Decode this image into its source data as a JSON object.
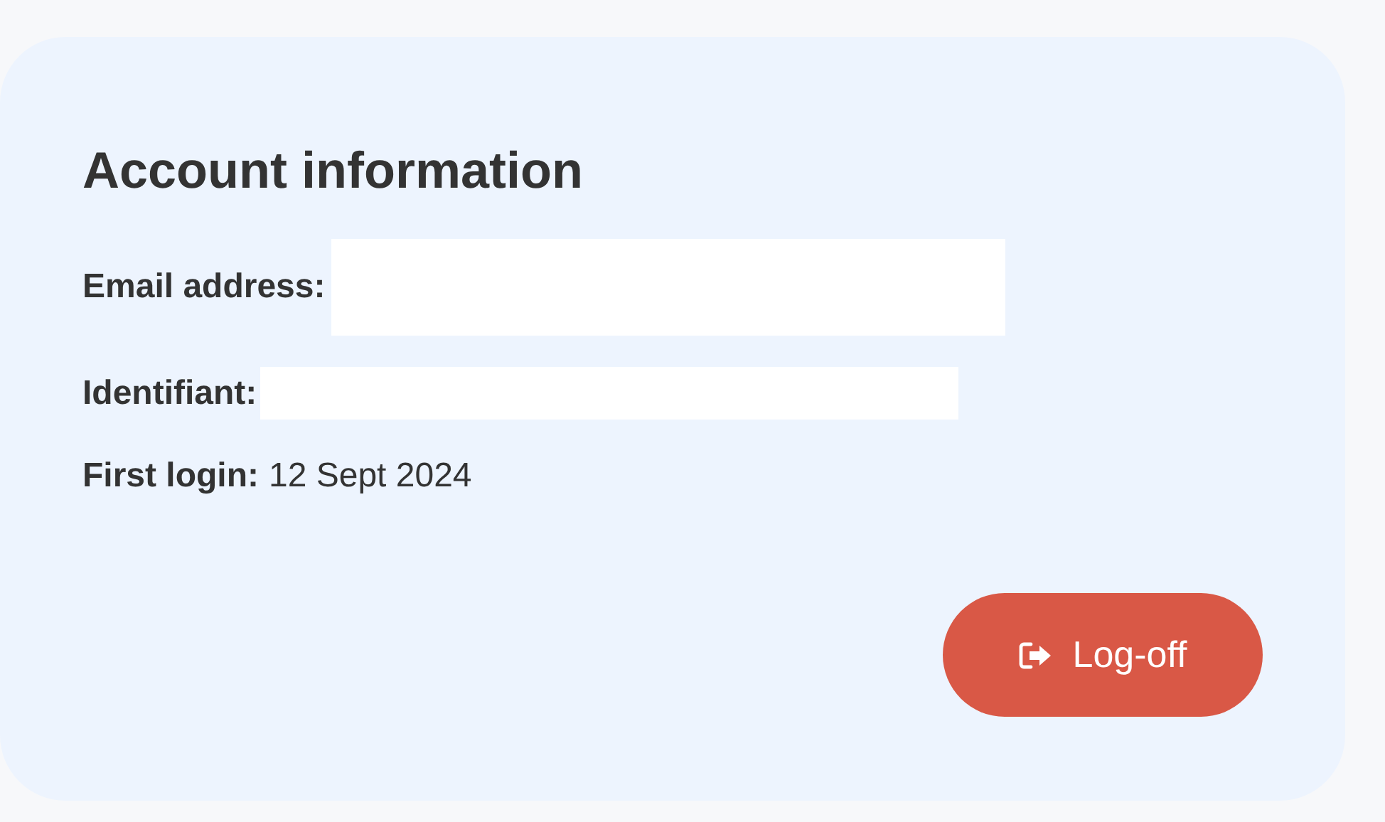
{
  "card": {
    "title": "Account information",
    "fields": [
      {
        "label": "Email address:",
        "redacted": true,
        "kind": "tall"
      },
      {
        "label": "Identifiant:",
        "redacted": true,
        "kind": "short"
      },
      {
        "label": "First login:",
        "value": "12 Sept 2024",
        "redacted": false
      }
    ],
    "button": {
      "label": "Log-off"
    }
  }
}
